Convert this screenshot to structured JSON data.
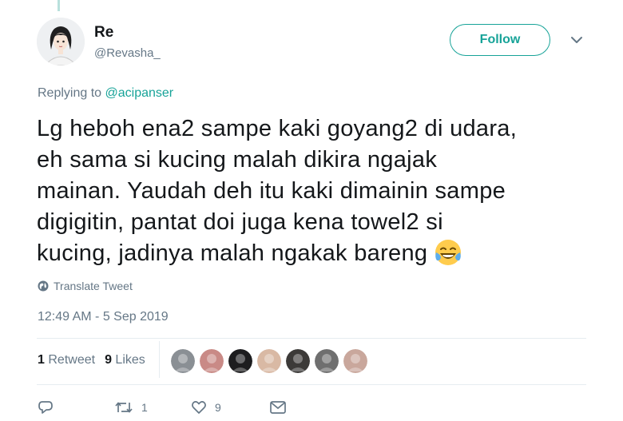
{
  "user": {
    "name": "Re",
    "handle": "@Revasha_",
    "follow_label": "Follow"
  },
  "reply": {
    "prefix": "Replying to ",
    "to": "@acipanser"
  },
  "tweet": {
    "text": "Lg heboh ena2 sampe kaki goyang2 di udara,\neh sama si kucing malah dikira ngajak\nmainan. Yaudah deh itu kaki dimainin sampe\ndigigitin, pantat doi juga kena towel2 si\nkucing, jadinya malah ngakak bareng",
    "emoji": "face-with-tears-of-joy",
    "translate_label": "Translate Tweet",
    "timestamp": "12:49 AM - 5 Sep 2019"
  },
  "stats": {
    "retweets": "1",
    "retweets_label": "Retweet",
    "likes": "9",
    "likes_label": "Likes"
  },
  "likers": [
    {
      "color": "#8a8f94"
    },
    {
      "color": "#c98a86"
    },
    {
      "color": "#1d1d1f"
    },
    {
      "color": "#d9b9a4"
    },
    {
      "color": "#3c3a38"
    },
    {
      "color": "#6f6f6f"
    },
    {
      "color": "#c9a79c"
    }
  ],
  "actions": {
    "retweet_count": "1",
    "like_count": "9"
  },
  "colors": {
    "accent": "#17a398",
    "muted": "#657786"
  }
}
